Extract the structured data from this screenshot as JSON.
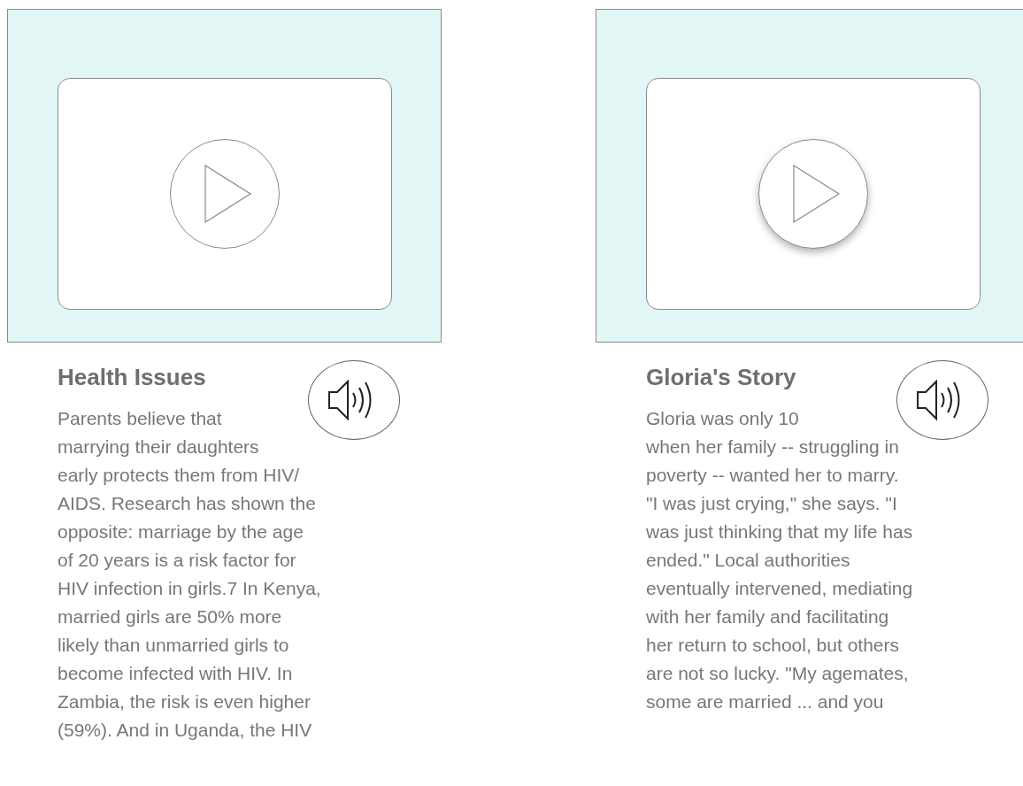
{
  "stories": [
    {
      "title": "Health Issues",
      "video": {
        "play_shadow": false
      },
      "text": "Parents believe that\nmarrying their daughters\nearly protects them from HIV/\nAIDS. Research has shown the\nopposite: marriage by the age\nof 20 years is a risk factor for\nHIV infection in girls.7 In Kenya,\nmarried girls are 50% more\nlikely than unmarried girls to\nbecome infected with HIV. In\nZambia, the risk is even higher\n(59%). And in Uganda, the HIV"
    },
    {
      "title": "Gloria's Story",
      "video": {
        "play_shadow": true
      },
      "text": "Gloria was only 10\nwhen her family -- struggling in\npoverty -- wanted her to marry.\n\"I was just crying,\" she says. \"I\nwas just thinking that my life has\nended.\" Local authorities\neventually intervened, mediating\nwith her family and facilitating\nher return to school, but others\nare not so lucky. \"My agemates,\nsome are married ... and you"
    }
  ]
}
